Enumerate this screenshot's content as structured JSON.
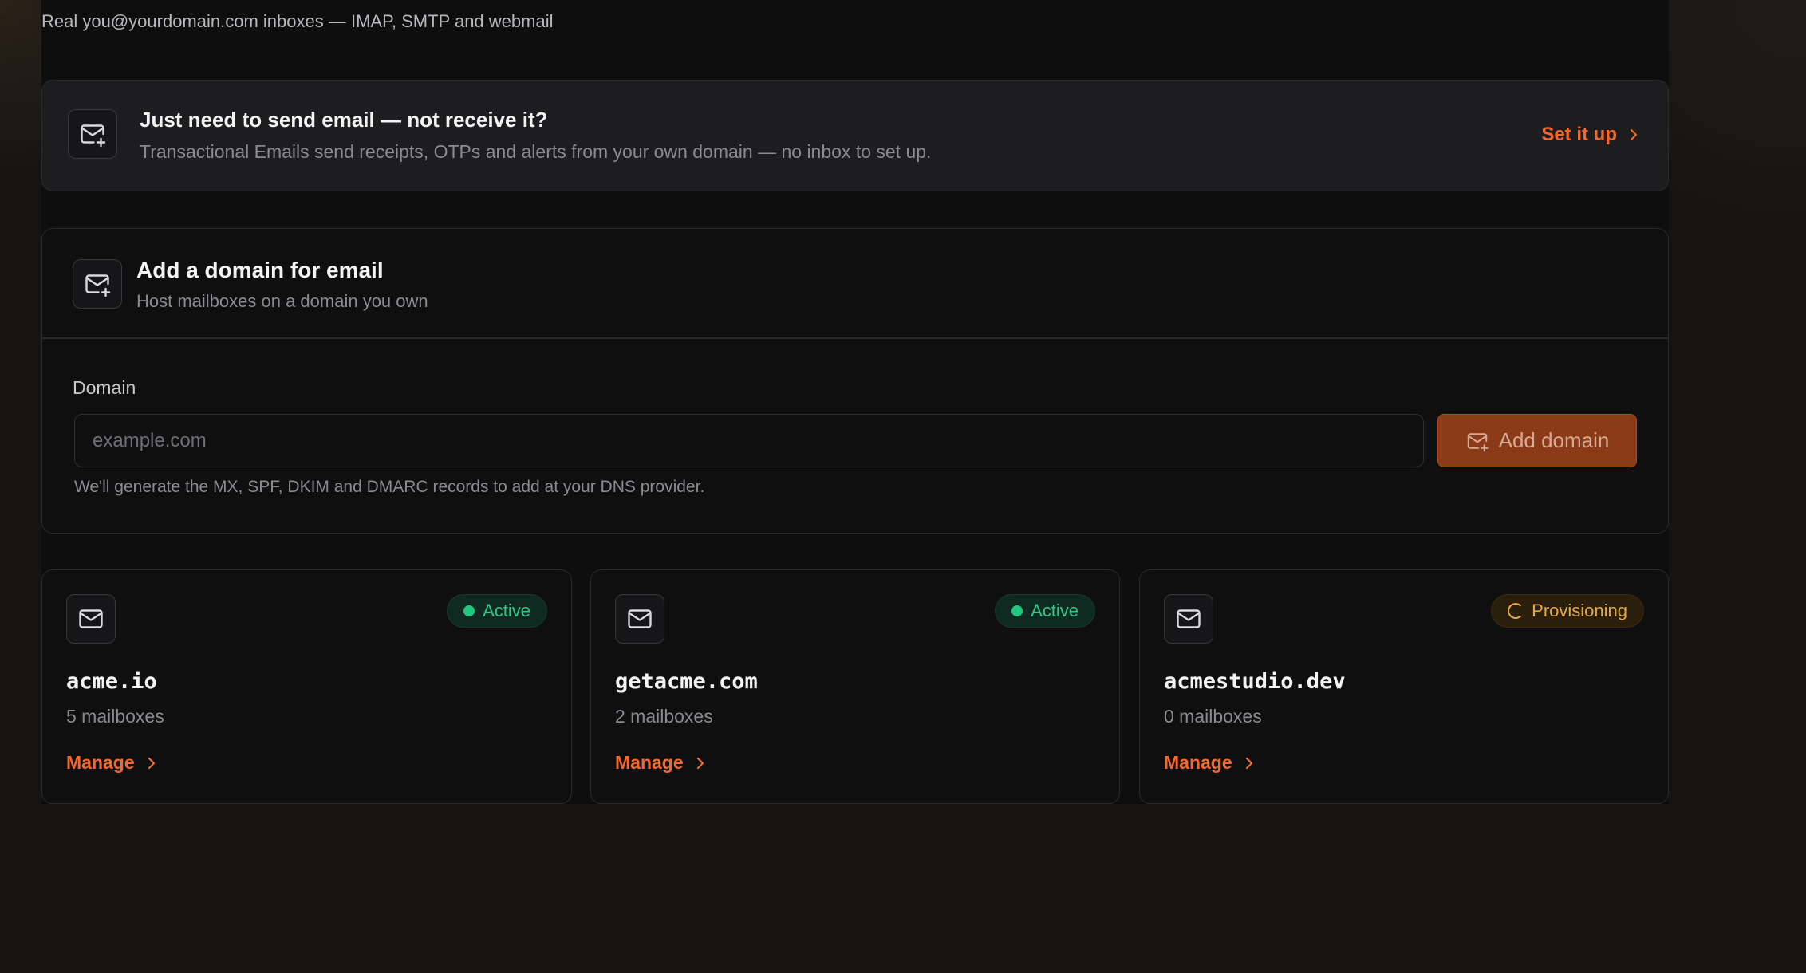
{
  "header": {
    "subtitle": "Real you@yourdomain.com inboxes — IMAP, SMTP and webmail"
  },
  "banner": {
    "icon": "mail-plus-icon",
    "title": "Just need to send email — not receive it?",
    "description": "Transactional Emails send receipts, OTPs and alerts from your own domain — no inbox to set up.",
    "link_label": "Set it up"
  },
  "add_domain": {
    "icon": "mail-plus-icon",
    "title": "Add a domain for email",
    "subtitle": "Host mailboxes on a domain you own",
    "field_label": "Domain",
    "placeholder": "example.com",
    "value": "",
    "button_label": "Add domain",
    "helper": "We'll generate the MX, SPF, DKIM and DMARC records to add at your DNS provider."
  },
  "domains": [
    {
      "name": "acme.io",
      "mailboxes": "5 mailboxes",
      "status": "Active",
      "action": "Manage"
    },
    {
      "name": "getacme.com",
      "mailboxes": "2 mailboxes",
      "status": "Active",
      "action": "Manage"
    },
    {
      "name": "acmestudio.dev",
      "mailboxes": "0 mailboxes",
      "status": "Provisioning",
      "action": "Manage"
    }
  ],
  "colors": {
    "accent": "#f2692c",
    "active": "#2ec98a",
    "provisioning": "#e8a83a"
  }
}
